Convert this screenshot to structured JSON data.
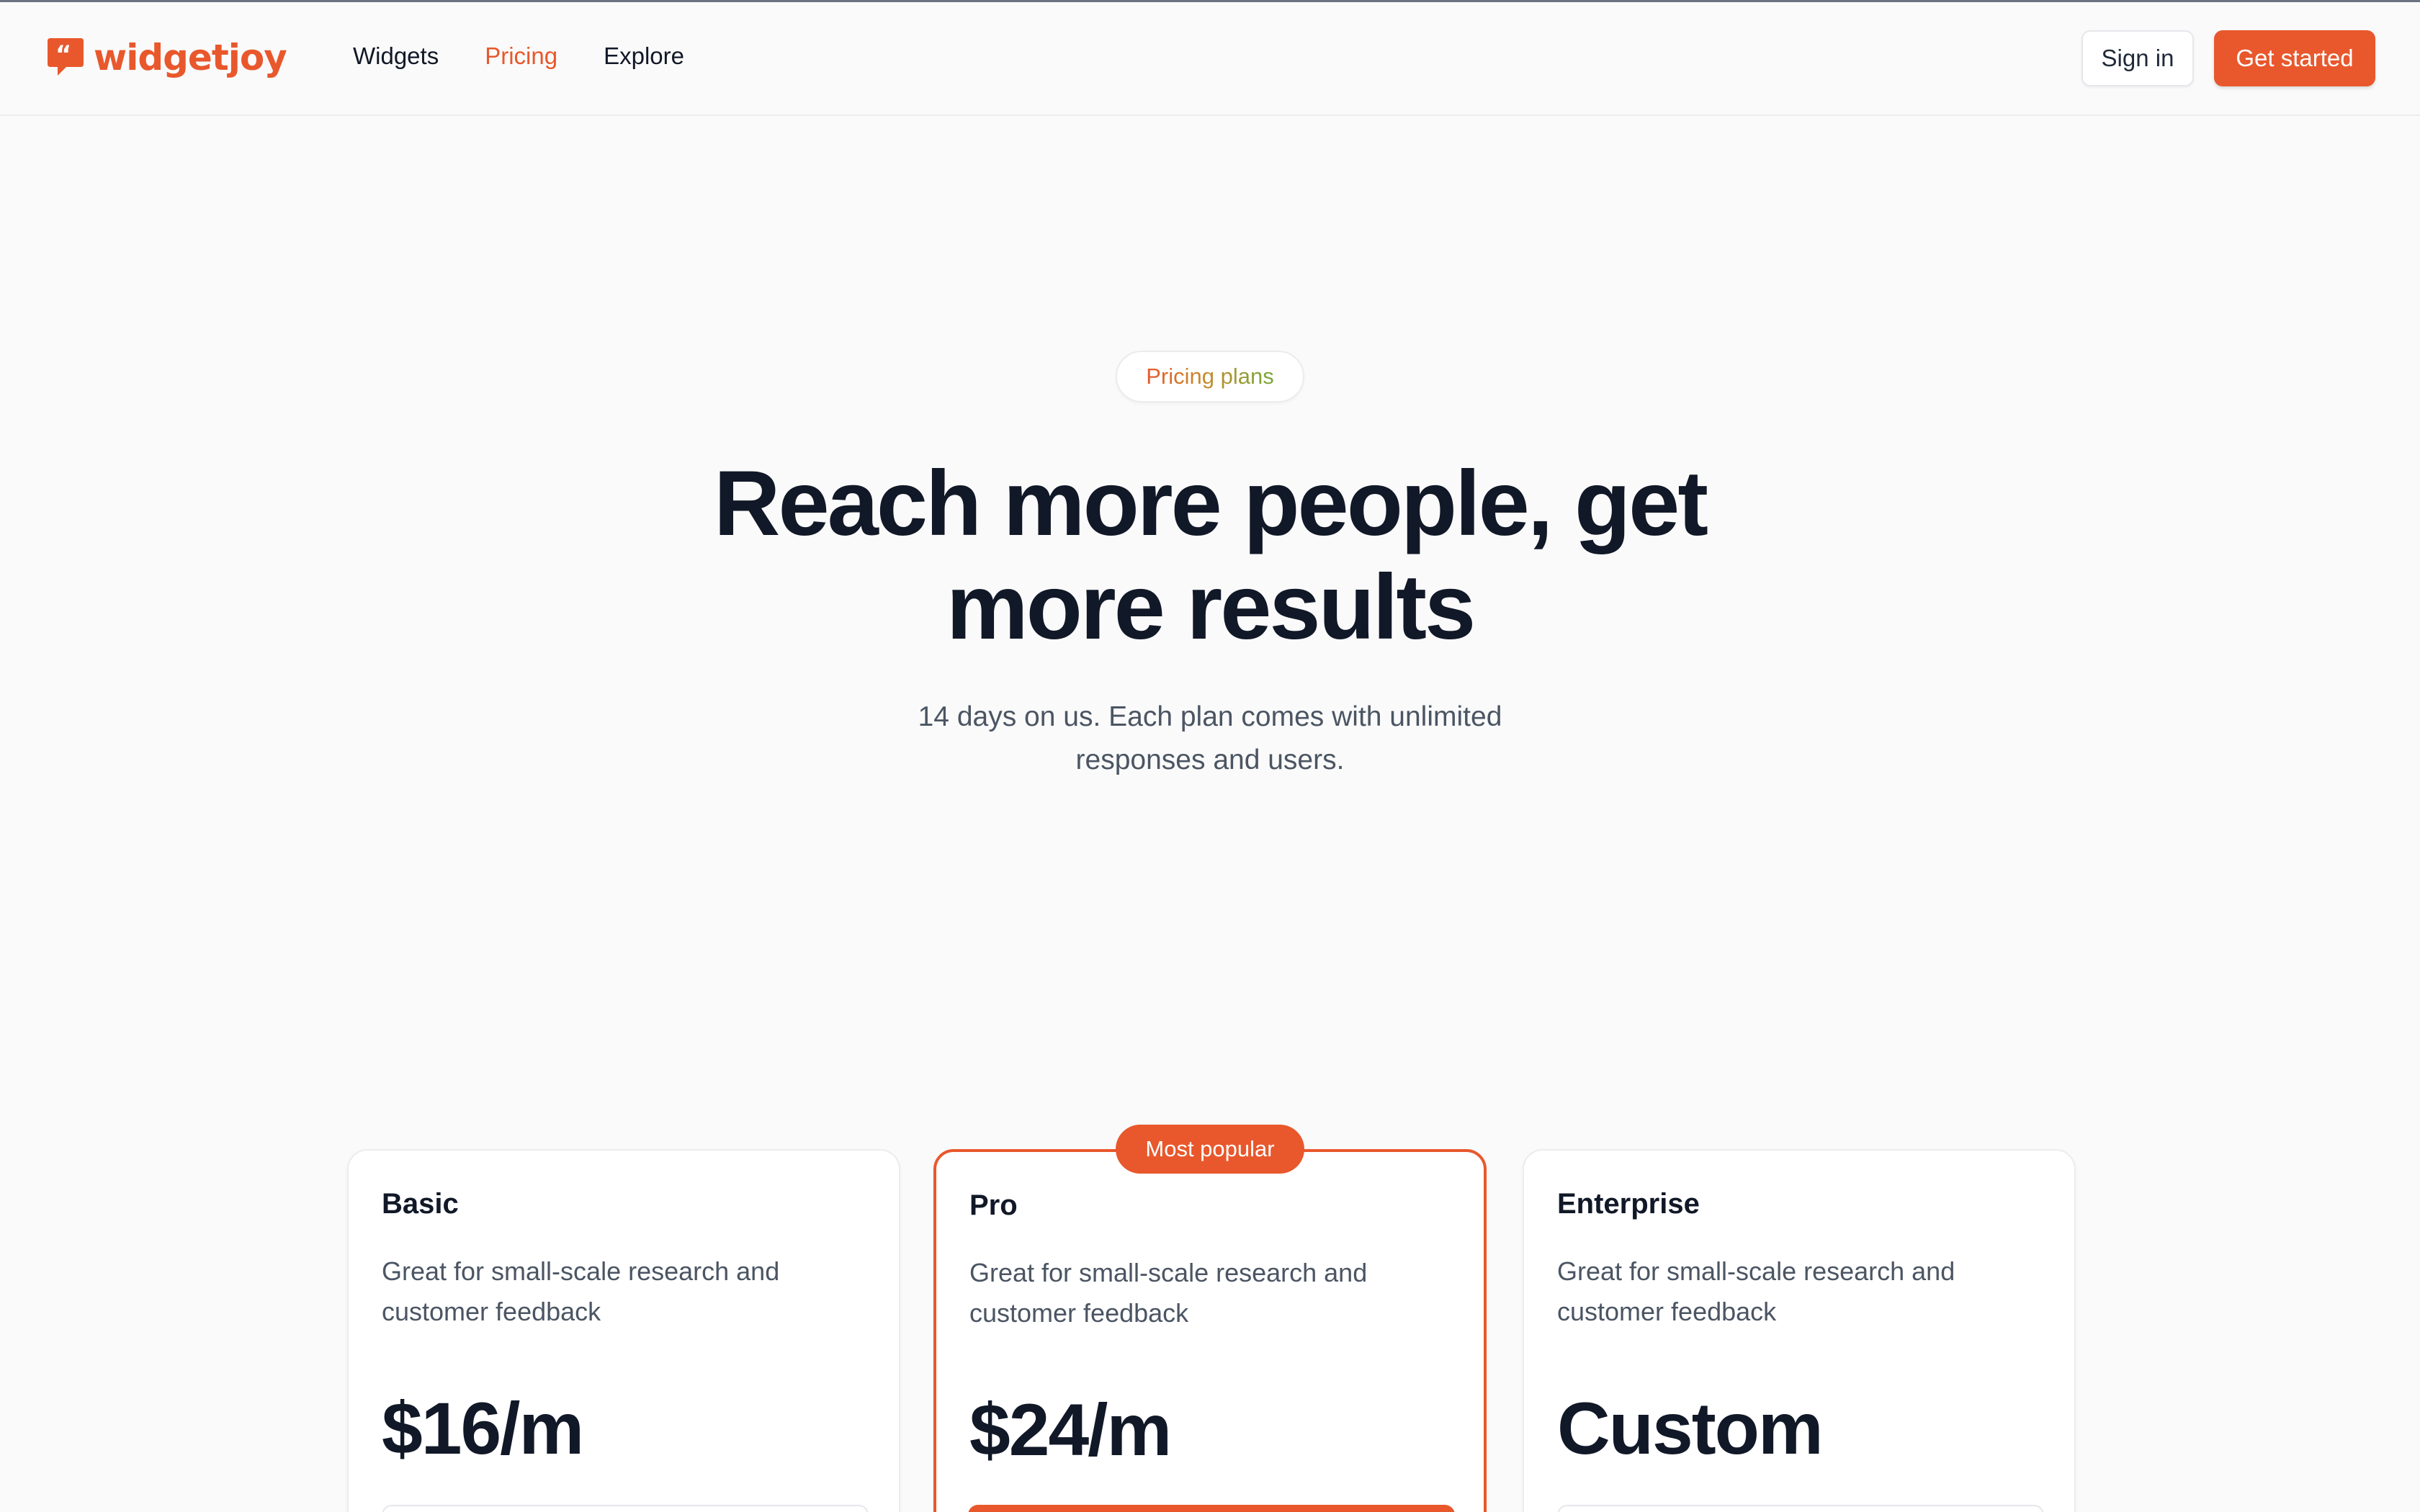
{
  "header": {
    "logo_text": "widgetjoy",
    "brand_color": "#e8582c",
    "nav": [
      {
        "label": "Widgets",
        "active": false
      },
      {
        "label": "Pricing",
        "active": true
      },
      {
        "label": "Explore",
        "active": false
      }
    ],
    "signin_label": "Sign in",
    "get_started_label": "Get started"
  },
  "hero": {
    "badge": "Pricing plans",
    "title": "Reach more people, get more results",
    "subtitle": "14 days on us. Each plan comes with unlimited responses and users."
  },
  "plans": [
    {
      "name": "Basic",
      "description": "Great for small-scale research and customer feedback",
      "price": "$16/m",
      "featured": false
    },
    {
      "name": "Pro",
      "description": "Great for small-scale research and customer feedback",
      "price": "$24/m",
      "featured": true,
      "featured_label": "Most popular"
    },
    {
      "name": "Enterprise",
      "description": "Great for small-scale research and customer feedback",
      "price": "Custom",
      "featured": false
    }
  ]
}
